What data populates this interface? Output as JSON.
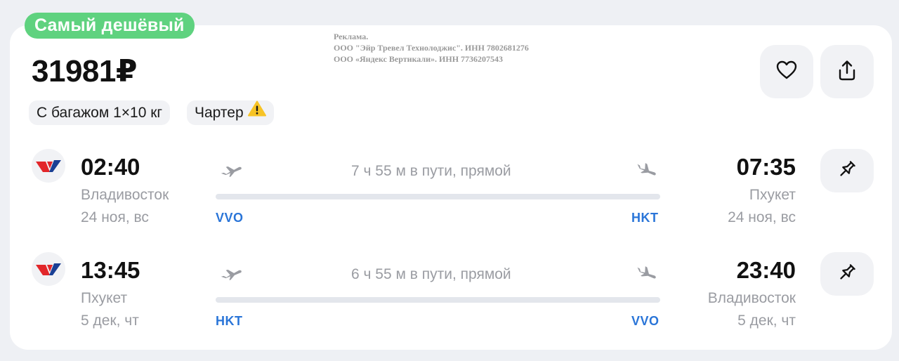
{
  "badge": "Самый дешёвый",
  "price": {
    "amount": "31981",
    "currency": "₽"
  },
  "ad": {
    "line1": "Реклама.",
    "line2": "ООО \"Эйр Тревел Технолоджис\". ИНН 7802681276",
    "line3": "ООО «Яндекс Вертикали». ИНН 7736207543"
  },
  "tags": {
    "baggage": "С багажом 1×10 кг",
    "charter": "Чартер"
  },
  "actions": {
    "favorite_icon": "heart-icon",
    "share_icon": "share-icon"
  },
  "colors": {
    "badge": "#5fd27f",
    "airport_code": "#2a75d8",
    "warning": "#f7c325",
    "airline_red": "#e2262a",
    "airline_blue": "#1a3f94"
  },
  "flights": [
    {
      "dep_time": "02:40",
      "dep_city": "Владивосток",
      "dep_date": "24 ноя, вс",
      "duration": "7 ч 55 м в пути, прямой",
      "dep_code": "VVO",
      "arr_code": "HKT",
      "arr_time": "07:35",
      "arr_city": "Пхукет",
      "arr_date": "24 ноя, вс"
    },
    {
      "dep_time": "13:45",
      "dep_city": "Пхукет",
      "dep_date": "5 дек, чт",
      "duration": "6 ч 55 м в пути, прямой",
      "dep_code": "HKT",
      "arr_code": "VVO",
      "arr_time": "23:40",
      "arr_city": "Владивосток",
      "arr_date": "5 дек, чт"
    }
  ]
}
